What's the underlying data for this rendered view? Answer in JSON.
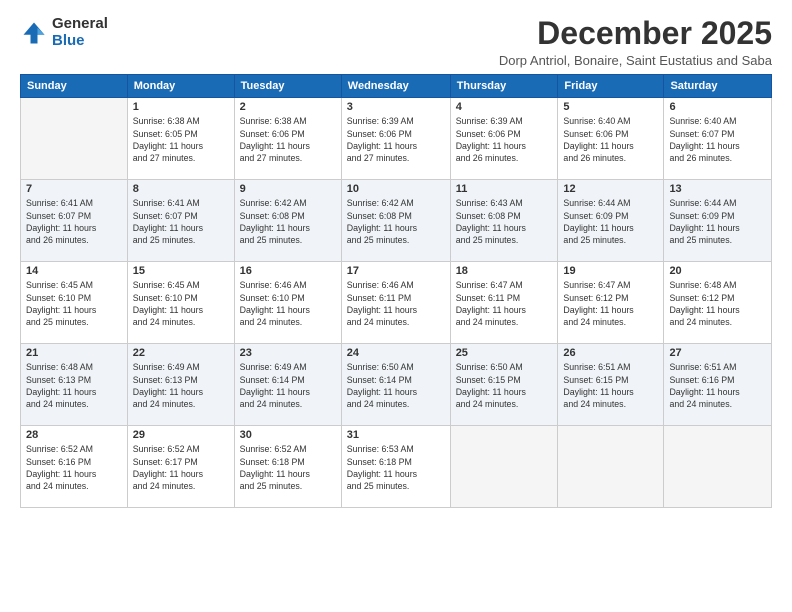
{
  "logo": {
    "general": "General",
    "blue": "Blue"
  },
  "header": {
    "month": "December 2025",
    "location": "Dorp Antriol, Bonaire, Saint Eustatius and Saba"
  },
  "weekdays": [
    "Sunday",
    "Monday",
    "Tuesday",
    "Wednesday",
    "Thursday",
    "Friday",
    "Saturday"
  ],
  "weeks": [
    [
      {
        "day": "",
        "info": ""
      },
      {
        "day": "1",
        "info": "Sunrise: 6:38 AM\nSunset: 6:05 PM\nDaylight: 11 hours\nand 27 minutes."
      },
      {
        "day": "2",
        "info": "Sunrise: 6:38 AM\nSunset: 6:06 PM\nDaylight: 11 hours\nand 27 minutes."
      },
      {
        "day": "3",
        "info": "Sunrise: 6:39 AM\nSunset: 6:06 PM\nDaylight: 11 hours\nand 27 minutes."
      },
      {
        "day": "4",
        "info": "Sunrise: 6:39 AM\nSunset: 6:06 PM\nDaylight: 11 hours\nand 26 minutes."
      },
      {
        "day": "5",
        "info": "Sunrise: 6:40 AM\nSunset: 6:06 PM\nDaylight: 11 hours\nand 26 minutes."
      },
      {
        "day": "6",
        "info": "Sunrise: 6:40 AM\nSunset: 6:07 PM\nDaylight: 11 hours\nand 26 minutes."
      }
    ],
    [
      {
        "day": "7",
        "info": "Sunrise: 6:41 AM\nSunset: 6:07 PM\nDaylight: 11 hours\nand 26 minutes."
      },
      {
        "day": "8",
        "info": "Sunrise: 6:41 AM\nSunset: 6:07 PM\nDaylight: 11 hours\nand 25 minutes."
      },
      {
        "day": "9",
        "info": "Sunrise: 6:42 AM\nSunset: 6:08 PM\nDaylight: 11 hours\nand 25 minutes."
      },
      {
        "day": "10",
        "info": "Sunrise: 6:42 AM\nSunset: 6:08 PM\nDaylight: 11 hours\nand 25 minutes."
      },
      {
        "day": "11",
        "info": "Sunrise: 6:43 AM\nSunset: 6:08 PM\nDaylight: 11 hours\nand 25 minutes."
      },
      {
        "day": "12",
        "info": "Sunrise: 6:44 AM\nSunset: 6:09 PM\nDaylight: 11 hours\nand 25 minutes."
      },
      {
        "day": "13",
        "info": "Sunrise: 6:44 AM\nSunset: 6:09 PM\nDaylight: 11 hours\nand 25 minutes."
      }
    ],
    [
      {
        "day": "14",
        "info": "Sunrise: 6:45 AM\nSunset: 6:10 PM\nDaylight: 11 hours\nand 25 minutes."
      },
      {
        "day": "15",
        "info": "Sunrise: 6:45 AM\nSunset: 6:10 PM\nDaylight: 11 hours\nand 24 minutes."
      },
      {
        "day": "16",
        "info": "Sunrise: 6:46 AM\nSunset: 6:10 PM\nDaylight: 11 hours\nand 24 minutes."
      },
      {
        "day": "17",
        "info": "Sunrise: 6:46 AM\nSunset: 6:11 PM\nDaylight: 11 hours\nand 24 minutes."
      },
      {
        "day": "18",
        "info": "Sunrise: 6:47 AM\nSunset: 6:11 PM\nDaylight: 11 hours\nand 24 minutes."
      },
      {
        "day": "19",
        "info": "Sunrise: 6:47 AM\nSunset: 6:12 PM\nDaylight: 11 hours\nand 24 minutes."
      },
      {
        "day": "20",
        "info": "Sunrise: 6:48 AM\nSunset: 6:12 PM\nDaylight: 11 hours\nand 24 minutes."
      }
    ],
    [
      {
        "day": "21",
        "info": "Sunrise: 6:48 AM\nSunset: 6:13 PM\nDaylight: 11 hours\nand 24 minutes."
      },
      {
        "day": "22",
        "info": "Sunrise: 6:49 AM\nSunset: 6:13 PM\nDaylight: 11 hours\nand 24 minutes."
      },
      {
        "day": "23",
        "info": "Sunrise: 6:49 AM\nSunset: 6:14 PM\nDaylight: 11 hours\nand 24 minutes."
      },
      {
        "day": "24",
        "info": "Sunrise: 6:50 AM\nSunset: 6:14 PM\nDaylight: 11 hours\nand 24 minutes."
      },
      {
        "day": "25",
        "info": "Sunrise: 6:50 AM\nSunset: 6:15 PM\nDaylight: 11 hours\nand 24 minutes."
      },
      {
        "day": "26",
        "info": "Sunrise: 6:51 AM\nSunset: 6:15 PM\nDaylight: 11 hours\nand 24 minutes."
      },
      {
        "day": "27",
        "info": "Sunrise: 6:51 AM\nSunset: 6:16 PM\nDaylight: 11 hours\nand 24 minutes."
      }
    ],
    [
      {
        "day": "28",
        "info": "Sunrise: 6:52 AM\nSunset: 6:16 PM\nDaylight: 11 hours\nand 24 minutes."
      },
      {
        "day": "29",
        "info": "Sunrise: 6:52 AM\nSunset: 6:17 PM\nDaylight: 11 hours\nand 24 minutes."
      },
      {
        "day": "30",
        "info": "Sunrise: 6:52 AM\nSunset: 6:18 PM\nDaylight: 11 hours\nand 25 minutes."
      },
      {
        "day": "31",
        "info": "Sunrise: 6:53 AM\nSunset: 6:18 PM\nDaylight: 11 hours\nand 25 minutes."
      },
      {
        "day": "",
        "info": ""
      },
      {
        "day": "",
        "info": ""
      },
      {
        "day": "",
        "info": ""
      }
    ]
  ]
}
